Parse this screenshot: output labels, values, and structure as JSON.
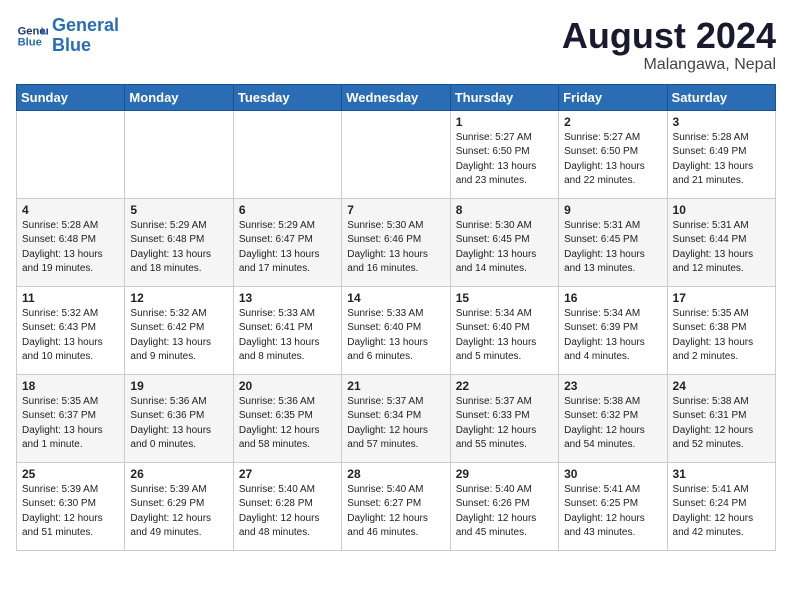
{
  "header": {
    "logo_line1": "General",
    "logo_line2": "Blue",
    "month_title": "August 2024",
    "location": "Malangawa, Nepal"
  },
  "days_of_week": [
    "Sunday",
    "Monday",
    "Tuesday",
    "Wednesday",
    "Thursday",
    "Friday",
    "Saturday"
  ],
  "weeks": [
    [
      {
        "day": "",
        "content": ""
      },
      {
        "day": "",
        "content": ""
      },
      {
        "day": "",
        "content": ""
      },
      {
        "day": "",
        "content": ""
      },
      {
        "day": "1",
        "content": "Sunrise: 5:27 AM\nSunset: 6:50 PM\nDaylight: 13 hours\nand 23 minutes."
      },
      {
        "day": "2",
        "content": "Sunrise: 5:27 AM\nSunset: 6:50 PM\nDaylight: 13 hours\nand 22 minutes."
      },
      {
        "day": "3",
        "content": "Sunrise: 5:28 AM\nSunset: 6:49 PM\nDaylight: 13 hours\nand 21 minutes."
      }
    ],
    [
      {
        "day": "4",
        "content": "Sunrise: 5:28 AM\nSunset: 6:48 PM\nDaylight: 13 hours\nand 19 minutes."
      },
      {
        "day": "5",
        "content": "Sunrise: 5:29 AM\nSunset: 6:48 PM\nDaylight: 13 hours\nand 18 minutes."
      },
      {
        "day": "6",
        "content": "Sunrise: 5:29 AM\nSunset: 6:47 PM\nDaylight: 13 hours\nand 17 minutes."
      },
      {
        "day": "7",
        "content": "Sunrise: 5:30 AM\nSunset: 6:46 PM\nDaylight: 13 hours\nand 16 minutes."
      },
      {
        "day": "8",
        "content": "Sunrise: 5:30 AM\nSunset: 6:45 PM\nDaylight: 13 hours\nand 14 minutes."
      },
      {
        "day": "9",
        "content": "Sunrise: 5:31 AM\nSunset: 6:45 PM\nDaylight: 13 hours\nand 13 minutes."
      },
      {
        "day": "10",
        "content": "Sunrise: 5:31 AM\nSunset: 6:44 PM\nDaylight: 13 hours\nand 12 minutes."
      }
    ],
    [
      {
        "day": "11",
        "content": "Sunrise: 5:32 AM\nSunset: 6:43 PM\nDaylight: 13 hours\nand 10 minutes."
      },
      {
        "day": "12",
        "content": "Sunrise: 5:32 AM\nSunset: 6:42 PM\nDaylight: 13 hours\nand 9 minutes."
      },
      {
        "day": "13",
        "content": "Sunrise: 5:33 AM\nSunset: 6:41 PM\nDaylight: 13 hours\nand 8 minutes."
      },
      {
        "day": "14",
        "content": "Sunrise: 5:33 AM\nSunset: 6:40 PM\nDaylight: 13 hours\nand 6 minutes."
      },
      {
        "day": "15",
        "content": "Sunrise: 5:34 AM\nSunset: 6:40 PM\nDaylight: 13 hours\nand 5 minutes."
      },
      {
        "day": "16",
        "content": "Sunrise: 5:34 AM\nSunset: 6:39 PM\nDaylight: 13 hours\nand 4 minutes."
      },
      {
        "day": "17",
        "content": "Sunrise: 5:35 AM\nSunset: 6:38 PM\nDaylight: 13 hours\nand 2 minutes."
      }
    ],
    [
      {
        "day": "18",
        "content": "Sunrise: 5:35 AM\nSunset: 6:37 PM\nDaylight: 13 hours\nand 1 minute."
      },
      {
        "day": "19",
        "content": "Sunrise: 5:36 AM\nSunset: 6:36 PM\nDaylight: 13 hours\nand 0 minutes."
      },
      {
        "day": "20",
        "content": "Sunrise: 5:36 AM\nSunset: 6:35 PM\nDaylight: 12 hours\nand 58 minutes."
      },
      {
        "day": "21",
        "content": "Sunrise: 5:37 AM\nSunset: 6:34 PM\nDaylight: 12 hours\nand 57 minutes."
      },
      {
        "day": "22",
        "content": "Sunrise: 5:37 AM\nSunset: 6:33 PM\nDaylight: 12 hours\nand 55 minutes."
      },
      {
        "day": "23",
        "content": "Sunrise: 5:38 AM\nSunset: 6:32 PM\nDaylight: 12 hours\nand 54 minutes."
      },
      {
        "day": "24",
        "content": "Sunrise: 5:38 AM\nSunset: 6:31 PM\nDaylight: 12 hours\nand 52 minutes."
      }
    ],
    [
      {
        "day": "25",
        "content": "Sunrise: 5:39 AM\nSunset: 6:30 PM\nDaylight: 12 hours\nand 51 minutes."
      },
      {
        "day": "26",
        "content": "Sunrise: 5:39 AM\nSunset: 6:29 PM\nDaylight: 12 hours\nand 49 minutes."
      },
      {
        "day": "27",
        "content": "Sunrise: 5:40 AM\nSunset: 6:28 PM\nDaylight: 12 hours\nand 48 minutes."
      },
      {
        "day": "28",
        "content": "Sunrise: 5:40 AM\nSunset: 6:27 PM\nDaylight: 12 hours\nand 46 minutes."
      },
      {
        "day": "29",
        "content": "Sunrise: 5:40 AM\nSunset: 6:26 PM\nDaylight: 12 hours\nand 45 minutes."
      },
      {
        "day": "30",
        "content": "Sunrise: 5:41 AM\nSunset: 6:25 PM\nDaylight: 12 hours\nand 43 minutes."
      },
      {
        "day": "31",
        "content": "Sunrise: 5:41 AM\nSunset: 6:24 PM\nDaylight: 12 hours\nand 42 minutes."
      }
    ]
  ]
}
